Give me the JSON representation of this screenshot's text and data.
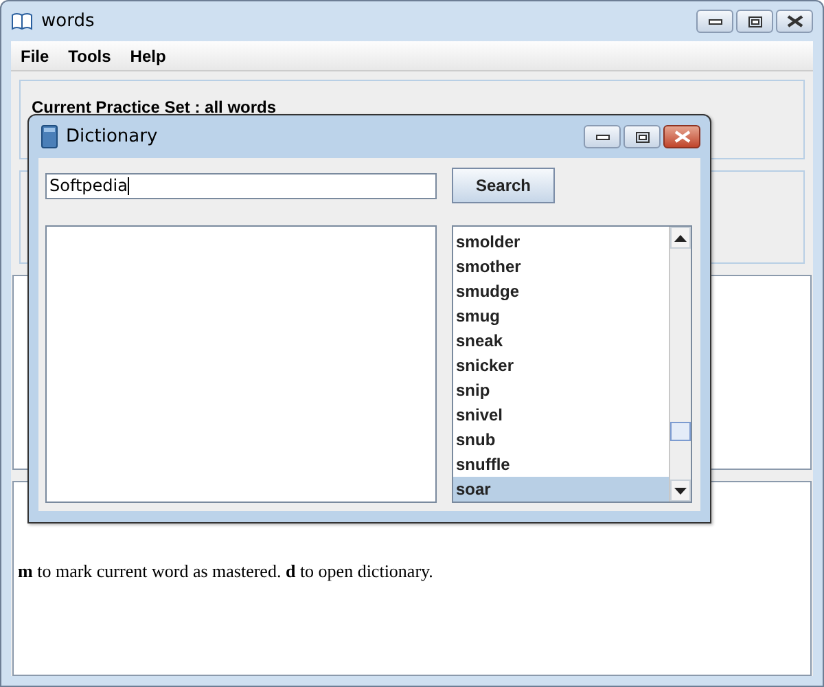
{
  "window": {
    "title": "words"
  },
  "menu": [
    {
      "label": "File"
    },
    {
      "label": "Tools"
    },
    {
      "label": "Help"
    }
  ],
  "practice_set": {
    "label": "Current Practice Set : all words"
  },
  "hint": "**m** to mark current word as mastered. **d** to open dictionary.",
  "dialog": {
    "title": "Dictionary",
    "search_field": {
      "value": "Softpedia"
    },
    "search_button": "Search",
    "words": [
      {
        "label": "smolder",
        "selected": false
      },
      {
        "label": "smother",
        "selected": false
      },
      {
        "label": "smudge",
        "selected": false
      },
      {
        "label": "smug",
        "selected": false
      },
      {
        "label": "sneak",
        "selected": false
      },
      {
        "label": "snicker",
        "selected": false
      },
      {
        "label": "snip",
        "selected": false
      },
      {
        "label": "snivel",
        "selected": false
      },
      {
        "label": "snub",
        "selected": false
      },
      {
        "label": "snuffle",
        "selected": false
      },
      {
        "label": "soar",
        "selected": true
      }
    ]
  }
}
